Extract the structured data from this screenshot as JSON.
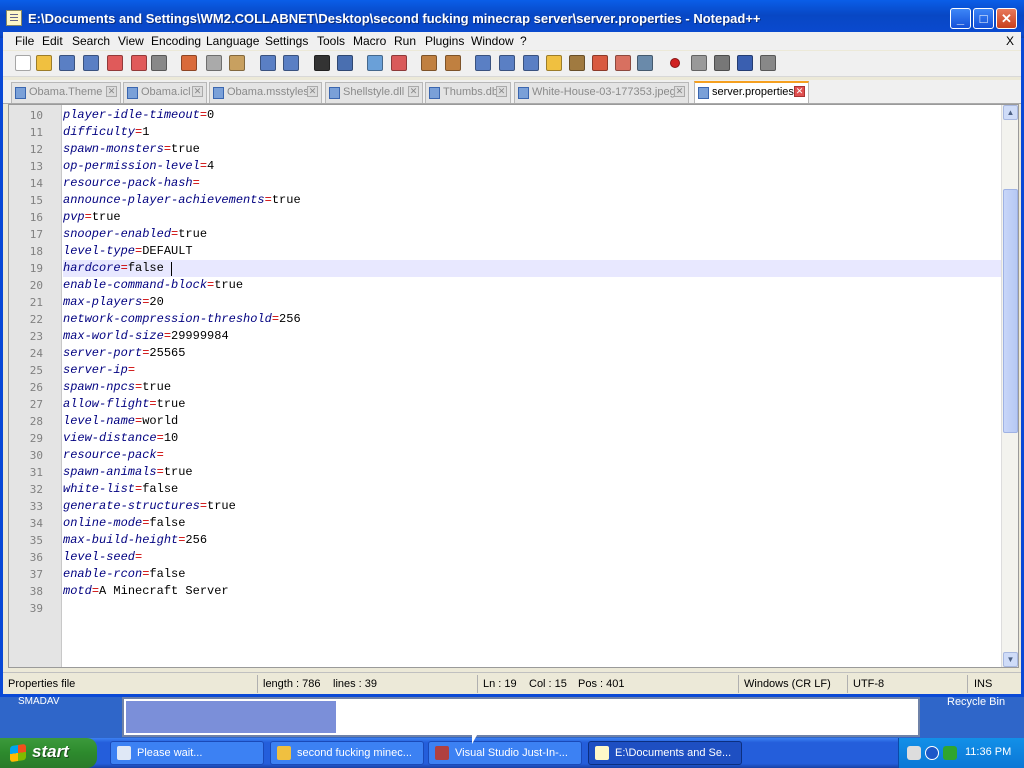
{
  "window": {
    "title": "E:\\Documents and Settings\\WM2.COLLABNET\\Desktop\\second fucking minecrap server\\server.properties - Notepad++",
    "minimize": "_",
    "maximize": "□",
    "close": "✕"
  },
  "menu": [
    "File",
    "Edit",
    "Search",
    "View",
    "Encoding",
    "Language",
    "Settings",
    "Tools",
    "Macro",
    "Run",
    "Plugins",
    "Window",
    "?"
  ],
  "menu_close": "X",
  "toolbar_icons": [
    "new-file-icon",
    "open-file-icon",
    "save-icon",
    "save-all-icon",
    "close-icon",
    "close-all-icon",
    "print-icon",
    "cut-icon",
    "copy-icon",
    "paste-icon",
    "undo-icon",
    "redo-icon",
    "find-icon",
    "replace-icon",
    "zoom-in-icon",
    "zoom-out-icon",
    "sync-v-icon",
    "sync-h-icon",
    "wrap-icon",
    "show-all-chars-icon",
    "indent-guide-icon",
    "folder-icon",
    "map-icon",
    "function-list-icon",
    "doc-map-icon",
    "monitor-icon",
    "record-macro-icon",
    "stop-macro-icon",
    "play-macro-icon",
    "run-macro-multiple-icon",
    "save-macro-icon"
  ],
  "tabs": [
    {
      "label": "Obama.Theme",
      "active": false
    },
    {
      "label": "Obama.icl",
      "active": false
    },
    {
      "label": "Obama.msstyles",
      "active": false
    },
    {
      "label": "Shellstyle.dll",
      "active": false
    },
    {
      "label": "Thumbs.db",
      "active": false
    },
    {
      "label": "White-House-03-177353.jpeg",
      "active": false
    },
    {
      "label": "server.properties",
      "active": true
    }
  ],
  "editor": {
    "lines": [
      {
        "n": "10",
        "key": "player-idle-timeout",
        "val": "0"
      },
      {
        "n": "11",
        "key": "difficulty",
        "val": "1"
      },
      {
        "n": "12",
        "key": "spawn-monsters",
        "val": "true"
      },
      {
        "n": "13",
        "key": "op-permission-level",
        "val": "4"
      },
      {
        "n": "14",
        "key": "resource-pack-hash",
        "val": ""
      },
      {
        "n": "15",
        "key": "announce-player-achievements",
        "val": "true"
      },
      {
        "n": "16",
        "key": "pvp",
        "val": "true"
      },
      {
        "n": "17",
        "key": "snooper-enabled",
        "val": "true"
      },
      {
        "n": "18",
        "key": "level-type",
        "val": "DEFAULT"
      },
      {
        "n": "19",
        "key": "hardcore",
        "val": "false",
        "current": true
      },
      {
        "n": "20",
        "key": "enable-command-block",
        "val": "true"
      },
      {
        "n": "21",
        "key": "max-players",
        "val": "20"
      },
      {
        "n": "22",
        "key": "network-compression-threshold",
        "val": "256"
      },
      {
        "n": "23",
        "key": "max-world-size",
        "val": "29999984"
      },
      {
        "n": "24",
        "key": "server-port",
        "val": "25565"
      },
      {
        "n": "25",
        "key": "server-ip",
        "val": ""
      },
      {
        "n": "26",
        "key": "spawn-npcs",
        "val": "true"
      },
      {
        "n": "27",
        "key": "allow-flight",
        "val": "true"
      },
      {
        "n": "28",
        "key": "level-name",
        "val": "world"
      },
      {
        "n": "29",
        "key": "view-distance",
        "val": "10"
      },
      {
        "n": "30",
        "key": "resource-pack",
        "val": ""
      },
      {
        "n": "31",
        "key": "spawn-animals",
        "val": "true"
      },
      {
        "n": "32",
        "key": "white-list",
        "val": "false"
      },
      {
        "n": "33",
        "key": "generate-structures",
        "val": "true"
      },
      {
        "n": "34",
        "key": "online-mode",
        "val": "false"
      },
      {
        "n": "35",
        "key": "max-build-height",
        "val": "256"
      },
      {
        "n": "36",
        "key": "level-seed",
        "val": ""
      },
      {
        "n": "37",
        "key": "enable-rcon",
        "val": "false"
      },
      {
        "n": "38",
        "key": "motd",
        "val": "A Minecraft Server"
      },
      {
        "n": "39",
        "key": "",
        "val": "",
        "empty": true
      }
    ]
  },
  "status": {
    "type": "Properties file",
    "length": "length : 786",
    "lines": "lines : 39",
    "ln": "Ln : 19",
    "col": "Col : 15",
    "pos": "Pos : 401",
    "eol": "Windows (CR LF)",
    "encoding": "UTF-8",
    "mode": "INS"
  },
  "desktop": {
    "left_label": "SMADAV",
    "right_label": "Recycle Bin",
    "progress_fraction": 0.265
  },
  "taskbar": {
    "start": "start",
    "tasks": [
      {
        "label": "Please wait...",
        "icon": "window-icon",
        "active": false
      },
      {
        "label": "second fucking minec...",
        "icon": "folder-icon",
        "active": false
      },
      {
        "label": "Visual Studio Just-In-...",
        "icon": "visual-studio-icon",
        "active": false
      },
      {
        "label": "E:\\Documents and Se...",
        "icon": "notepad-icon",
        "active": true
      }
    ],
    "clock": "11:36 PM"
  }
}
